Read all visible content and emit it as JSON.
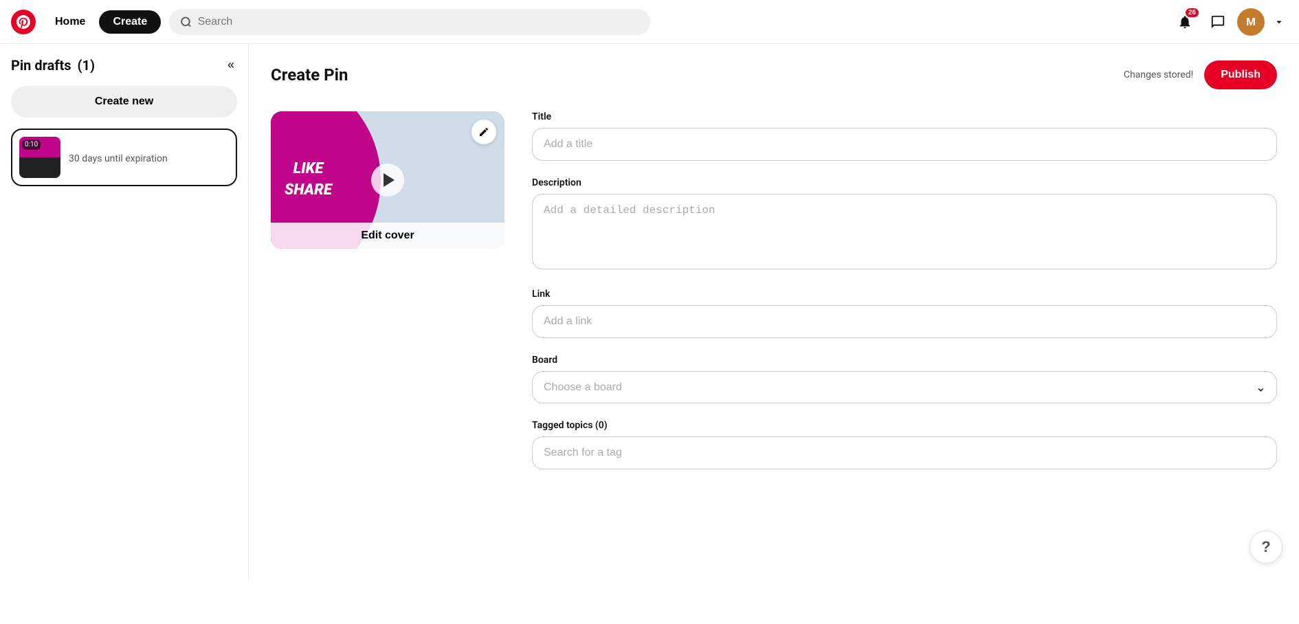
{
  "header": {
    "logo_alt": "Pinterest logo",
    "nav_home": "Home",
    "nav_create": "Create",
    "search_placeholder": "Search",
    "notification_count": "26",
    "avatar_letter": "M",
    "chevron": "▾"
  },
  "sidebar": {
    "title": "Pin drafts",
    "draft_count": "(1)",
    "collapse_icon": "«",
    "create_new_label": "Create new",
    "draft": {
      "timer": "0:10",
      "expiry_text": "30 days until expiration"
    }
  },
  "main": {
    "page_title": "Create Pin",
    "changes_stored_text": "Changes stored!",
    "publish_label": "Publish"
  },
  "pin_form": {
    "title_label": "Title",
    "title_placeholder": "Add a title",
    "description_label": "Description",
    "description_placeholder": "Add a detailed description",
    "link_label": "Link",
    "link_placeholder": "Add a link",
    "board_label": "Board",
    "board_placeholder": "Choose a board",
    "tagged_topics_label": "Tagged topics (0)",
    "tag_placeholder": "Search for a tag"
  },
  "media_preview": {
    "video_text_line1": "LIKE",
    "video_text_line2": "SHARE",
    "edit_cover_label": "Edit cover"
  },
  "help": {
    "label": "?"
  }
}
